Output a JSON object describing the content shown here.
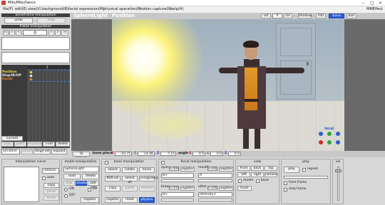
{
  "window": {
    "title": "MikuMikuDance",
    "accent": "#2c5fd7"
  },
  "menu": {
    "items": [
      "file(F)",
      "edit(E)",
      "view(V)",
      "background(B)",
      "facial expression(M)",
      "physical operation(P)",
      "motion capture(N)",
      "help(H)"
    ],
    "right": "MMEffect"
  },
  "left": {
    "bone_title": "bone/frame manipulation",
    "undo": "undo",
    "redo": "redo",
    "frame_title": "frame manipulation",
    "frame_value": "0",
    "tl_label": "5",
    "tracks": [
      {
        "name": "Position",
        "color": "#f0e24a"
      },
      {
        "name": "Disp/IK/OP",
        "color": "#f4f4f4"
      },
      {
        "name": "Facial",
        "color": "#f08a30"
      }
    ],
    "current_label": "current",
    "row1": [
      "copy",
      "paste",
      "invpaste",
      "v-sel",
      "delete"
    ],
    "row2": [
      "select",
      "range-sel",
      "expand"
    ],
    "selbone": "Sel Bone"
  },
  "viewport": {
    "model": "SphereLight",
    "mode": "Position",
    "btns": [
      "set",
      "0",
      "Go",
      "Shadow",
      "info",
      "bone view",
      "axis"
    ],
    "camera_label": "local"
  },
  "status": {
    "to_camera": "To camera",
    "bone_label": "bone place",
    "x": "-10.75",
    "y": "14.46",
    "z": "-7.15",
    "angle_label": "angle",
    "ax": "0.0",
    "ay": "0.0",
    "az": "0.0"
  },
  "interp": {
    "title": "Interpolation curve",
    "rotation": "rotation",
    "auto_label": "auto",
    "copy": "copy",
    "paste": "paste",
    "linear": "linear"
  },
  "model_panel": {
    "title": "model manipulation",
    "model": "SphereLight",
    "load": "load",
    "delete": "delete",
    "disp": "disp",
    "shadow": "shadow",
    "add_sync": "add-syn",
    "on": "ON",
    "off": "OFF",
    "op": "OP",
    "register": "register"
  },
  "bone_panel": {
    "title": "bone manipulation",
    "select": "select",
    "rotate": "rotate",
    "move": "move",
    "box_sel": "BOX-sel",
    "select_all": "select all",
    "unregister": "unregistered",
    "copy": "copy",
    "paste": "paste",
    "reverse": "reverse",
    "register": "register",
    "reset": "reset",
    "physics": "physics"
  },
  "facial_panel": {
    "title": "facial manipulation",
    "groups": [
      {
        "label": "eyes",
        "value": "0.000",
        "sel": "B+",
        "btn": "register"
      },
      {
        "label": "mouth",
        "value": "0.000",
        "sel": "A",
        "btn": "register"
      },
      {
        "label": "brow",
        "value": "0.000",
        "sel": "B+",
        "btn": "register"
      },
      {
        "label": "other",
        "value": "0.000",
        "sel": "Intensity+",
        "btn": "register"
      }
    ]
  },
  "view_panel": {
    "title": "view",
    "btns": [
      "front",
      "back",
      "top",
      "left",
      "right",
      "camera",
      "track"
    ],
    "model": "model",
    "bone": "bone"
  },
  "play_panel": {
    "title": "play",
    "play": "play",
    "repeat": "repeat",
    "vol_label": "vol",
    "from": "from frame",
    "to": "stop frame"
  }
}
